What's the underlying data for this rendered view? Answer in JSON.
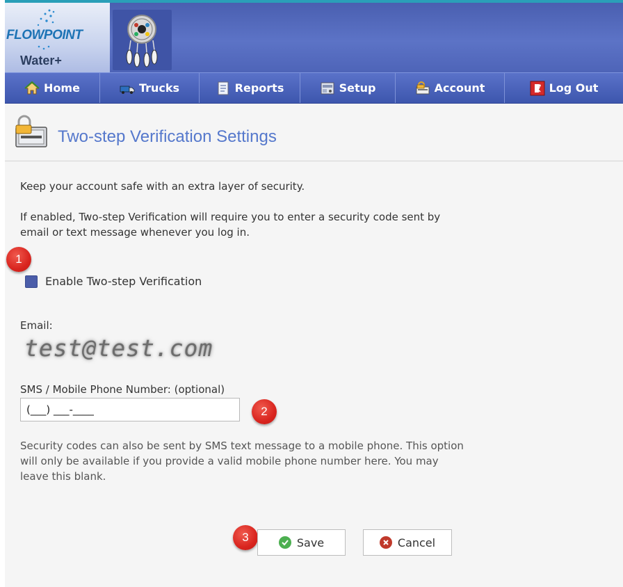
{
  "branding": {
    "logo_name": "FLOWPOINT",
    "logo_sub": "Water+"
  },
  "nav": {
    "items": [
      {
        "label": "Home",
        "icon": "home-icon"
      },
      {
        "label": "Trucks",
        "icon": "truck-icon"
      },
      {
        "label": "Reports",
        "icon": "report-icon"
      },
      {
        "label": "Setup",
        "icon": "setup-icon"
      },
      {
        "label": "Account",
        "icon": "account-icon"
      },
      {
        "label": "Log Out",
        "icon": "logout-icon"
      }
    ]
  },
  "page": {
    "title": "Two-step Verification Settings",
    "intro": "Keep your account safe with an extra layer of security.",
    "description": "If enabled, Two-step Verification will require you to enter a security code sent by email or text message whenever you log in."
  },
  "annotations": {
    "badge1": "1",
    "badge2": "2",
    "badge3": "3"
  },
  "form": {
    "enable_label": "Enable Two-step Verification",
    "enable_checked": false,
    "email_label": "Email:",
    "email_value": "test@test.com",
    "phone_label": "SMS / Mobile Phone Number: (optional)",
    "phone_value": "(___) ___-____",
    "help_text": "Security codes can also be sent by SMS text message to a mobile phone. This option will only be available if you provide a valid mobile phone number here. You may leave this blank.",
    "save_label": "Save",
    "cancel_label": "Cancel"
  },
  "colors": {
    "header_blue": "#4a5fb0",
    "title_blue": "#5578cc",
    "badge_red": "#d9251f",
    "save_green": "#4caf50",
    "cancel_red": "#c0392b"
  }
}
